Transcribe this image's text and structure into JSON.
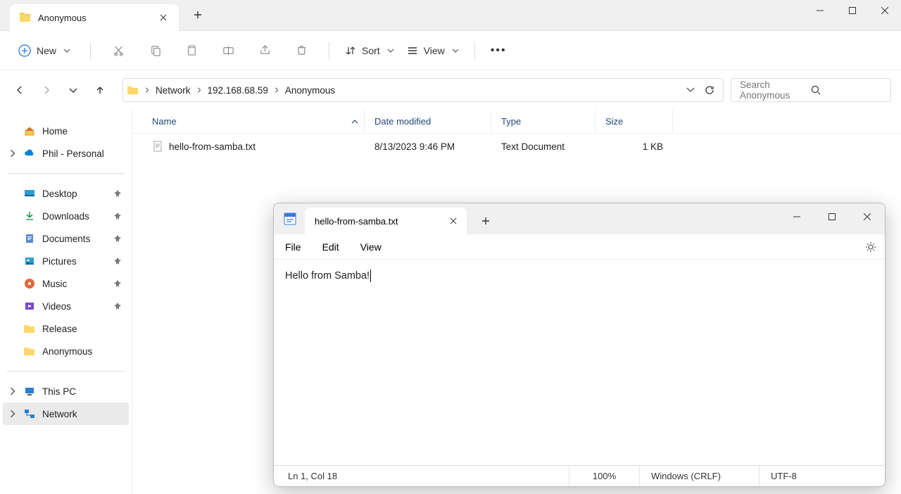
{
  "explorer": {
    "tab_title": "Anonymous",
    "toolbar": {
      "new_label": "New",
      "sort_label": "Sort",
      "view_label": "View"
    },
    "breadcrumb": [
      "Network",
      "192.168.68.59",
      "Anonymous"
    ],
    "search_placeholder": "Search Anonymous",
    "columns": {
      "name": "Name",
      "date": "Date modified",
      "type": "Type",
      "size": "Size"
    },
    "files": [
      {
        "name": "hello-from-samba.txt",
        "date": "8/13/2023 9:46 PM",
        "type": "Text Document",
        "size": "1 KB"
      }
    ],
    "sidebar": {
      "home": "Home",
      "onedrive": "Phil - Personal",
      "quick": [
        "Desktop",
        "Downloads",
        "Documents",
        "Pictures",
        "Music",
        "Videos",
        "Release",
        "Anonymous"
      ],
      "thispc": "This PC",
      "network": "Network"
    }
  },
  "notepad": {
    "tab_title": "hello-from-samba.txt",
    "menu": {
      "file": "File",
      "edit": "Edit",
      "view": "View"
    },
    "content": "Hello from Samba!",
    "status": {
      "pos": "Ln 1, Col 18",
      "zoom": "100%",
      "line_ending": "Windows (CRLF)",
      "encoding": "UTF-8"
    }
  }
}
